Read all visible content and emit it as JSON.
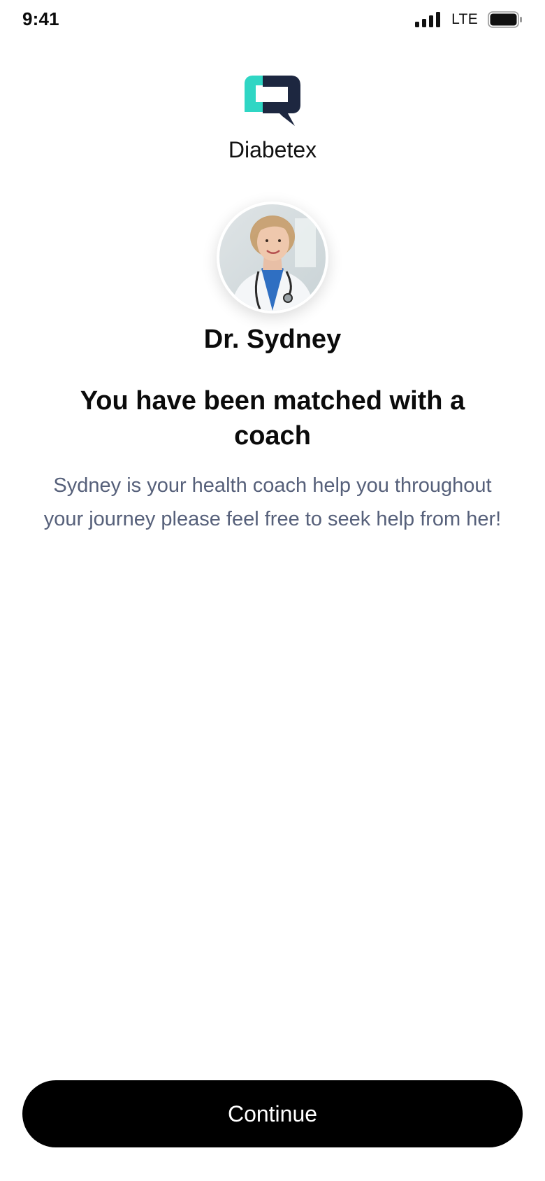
{
  "status_bar": {
    "time": "9:41",
    "network": "LTE",
    "icons": [
      "signal-bars-icon",
      "battery-full-icon"
    ]
  },
  "brand": {
    "name": "Diabetex",
    "logo_icon": "chat-bubble-logo-icon",
    "colors": {
      "logo_teal": "#2fd6c4",
      "logo_dark": "#1d2740"
    }
  },
  "coach": {
    "name": "Dr. Sydney",
    "avatar_icon": "doctor-portrait-avatar"
  },
  "match": {
    "title": "You have been matched with a coach",
    "description": "Sydney is your health coach help you throughout your journey please feel free to seek help from her!"
  },
  "actions": {
    "continue_label": "Continue"
  },
  "colors": {
    "button_bg": "#000000",
    "button_text": "#ffffff",
    "description_text": "#56607a"
  }
}
